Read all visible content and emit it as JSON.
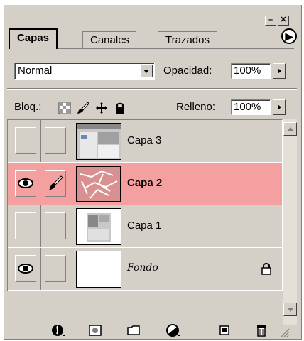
{
  "tabs": [
    "Capas",
    "Canales",
    "Trazados"
  ],
  "blend_mode": {
    "value": "Normal"
  },
  "opacity": {
    "label": "Opacidad:",
    "value": "100%"
  },
  "lock": {
    "label": "Bloq.:"
  },
  "fill": {
    "label": "Relleno:",
    "value": "100%"
  },
  "layers": [
    {
      "name": "Capa 3",
      "visible": false,
      "selected": false,
      "locked": false
    },
    {
      "name": "Capa 2",
      "visible": true,
      "selected": true,
      "locked": false
    },
    {
      "name": "Capa 1",
      "visible": false,
      "selected": false,
      "locked": false
    },
    {
      "name": "Fondo",
      "visible": true,
      "selected": false,
      "locked": true
    }
  ],
  "colors": {
    "panel": "#d4d0c8",
    "selection": "#f4a0a0"
  },
  "icons": [
    "layer-style-icon",
    "mask-icon",
    "folder-icon",
    "adjustment-icon",
    "new-layer-icon",
    "trash-icon"
  ]
}
